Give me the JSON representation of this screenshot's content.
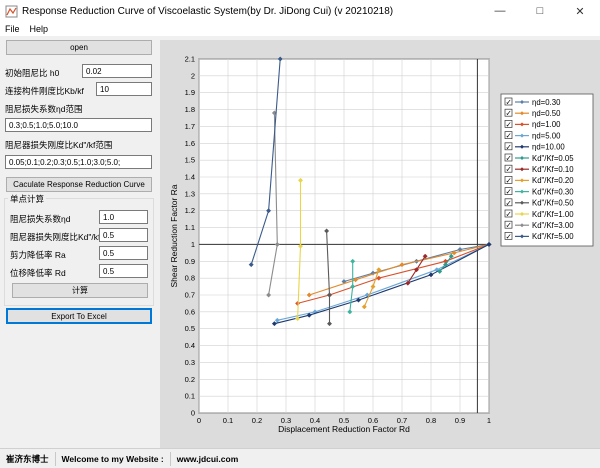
{
  "window": {
    "title": "Response Reduction Curve of Viscoelastic System(by Dr. JiDong Cui) (v 20210218)"
  },
  "menu": {
    "file": "File",
    "help": "Help"
  },
  "left": {
    "open_label": "open",
    "h0_label": "初始阻尼比 h0",
    "h0_value": "0.02",
    "kbkf_label": "连接构件刚度比Kb/kf",
    "kbkf_value": "10",
    "nd_range_label": "阻尼损失系数ηd范围",
    "nd_range_value": "0.3;0.5;1.0;5.0;10.0",
    "kd_range_label": "阻尼器损失刚度比Kd\"/kf范围",
    "kd_range_value": "0.05;0.1;0.2;0.3;0.5;1.0;3.0;5.0;",
    "calc_curve_label": "Caculate Response Reduction Curve",
    "single_group_label": "单点计算",
    "nd_label": "阻尼损失系数ηd",
    "nd_value": "1.0",
    "kd_label": "阻尼器损失刚度比Kd\"/kf",
    "kd_value": "0.5",
    "ra_label": "剪力降低率 Ra",
    "ra_value": "0.5",
    "rd_label": "位移降低率 Rd",
    "rd_value": "0.5",
    "compute_label": "计算",
    "export_label": "Export To Excel"
  },
  "status": {
    "author": "崔济东博士",
    "welcome": "Welcome to my Website :",
    "website": "www.jdcui.com"
  },
  "chart_data": {
    "type": "line",
    "xlabel": "Displacement Reduction Factor Rd",
    "ylabel": "Shear Reduction Factor Ra",
    "xlim": [
      0,
      1
    ],
    "ylim": [
      0,
      2.1
    ],
    "x_ticks": [
      "0",
      "0.1",
      "0.2",
      "0.3",
      "0.4",
      "0.5",
      "0.6",
      "0.7",
      "0.8",
      "0.9",
      "1"
    ],
    "y_ticks": [
      "0",
      "0.1",
      "0.2",
      "0.3",
      "0.4",
      "0.5",
      "0.6",
      "0.7",
      "0.8",
      "0.9",
      "1",
      "1.1",
      "1.2",
      "1.3",
      "1.4",
      "1.5",
      "1.6",
      "1.7",
      "1.8",
      "1.9",
      "2",
      "2.1"
    ],
    "ref_lines": {
      "x": 0.96,
      "y": 1.0
    },
    "grid": true,
    "legend_position": "right",
    "series": [
      {
        "name": "ηd=0.30",
        "color": "#5b7fa8",
        "marker": "diamond",
        "points": [
          [
            1,
            1
          ],
          [
            0.9,
            0.97
          ],
          [
            0.75,
            0.9
          ],
          [
            0.6,
            0.83
          ],
          [
            0.5,
            0.78
          ]
        ]
      },
      {
        "name": "ηd=0.50",
        "color": "#e38a2c",
        "marker": "diamond",
        "points": [
          [
            1,
            1
          ],
          [
            0.88,
            0.95
          ],
          [
            0.7,
            0.88
          ],
          [
            0.54,
            0.79
          ],
          [
            0.38,
            0.7
          ]
        ]
      },
      {
        "name": "ηd=1.00",
        "color": "#d9502a",
        "marker": "diamond",
        "points": [
          [
            1,
            1
          ],
          [
            0.85,
            0.9
          ],
          [
            0.62,
            0.8
          ],
          [
            0.45,
            0.7
          ],
          [
            0.34,
            0.65
          ]
        ]
      },
      {
        "name": "ηd=5.00",
        "color": "#6aa6d6",
        "marker": "diamond",
        "points": [
          [
            1,
            1
          ],
          [
            0.82,
            0.85
          ],
          [
            0.58,
            0.7
          ],
          [
            0.4,
            0.6
          ],
          [
            0.27,
            0.55
          ]
        ]
      },
      {
        "name": "ηd=10.00",
        "color": "#1f3a70",
        "marker": "diamond",
        "points": [
          [
            1,
            1
          ],
          [
            0.8,
            0.82
          ],
          [
            0.55,
            0.67
          ],
          [
            0.38,
            0.58
          ],
          [
            0.26,
            0.53
          ]
        ]
      },
      {
        "name": "Kd\"/Kf=0.05",
        "color": "#2e9c8e",
        "marker": "diamond",
        "points": [
          [
            0.87,
            0.93
          ],
          [
            0.85,
            0.88
          ],
          [
            0.83,
            0.84
          ]
        ]
      },
      {
        "name": "Kd\"/Kf=0.10",
        "color": "#9c2a2a",
        "marker": "diamond",
        "points": [
          [
            0.78,
            0.93
          ],
          [
            0.75,
            0.85
          ],
          [
            0.72,
            0.77
          ]
        ]
      },
      {
        "name": "Kd\"/Kf=0.20",
        "color": "#e3a02c",
        "marker": "diamond",
        "points": [
          [
            0.62,
            0.85
          ],
          [
            0.6,
            0.75
          ],
          [
            0.57,
            0.63
          ]
        ]
      },
      {
        "name": "Kd\"/Kf=0.30",
        "color": "#3cb4a0",
        "marker": "diamond",
        "points": [
          [
            0.53,
            0.9
          ],
          [
            0.53,
            0.75
          ],
          [
            0.52,
            0.6
          ]
        ]
      },
      {
        "name": "Kd\"/Kf=0.50",
        "color": "#5a5a5a",
        "marker": "diamond",
        "points": [
          [
            0.44,
            1.08
          ],
          [
            0.45,
            0.7
          ],
          [
            0.45,
            0.53
          ]
        ]
      },
      {
        "name": "Kd\"/Kf=1.00",
        "color": "#e8d54a",
        "marker": "diamond",
        "points": [
          [
            0.35,
            1.38
          ],
          [
            0.35,
            0.99
          ],
          [
            0.34,
            0.56
          ]
        ]
      },
      {
        "name": "Kd\"/Kf=3.00",
        "color": "#8c8c8c",
        "marker": "diamond",
        "points": [
          [
            0.26,
            1.78
          ],
          [
            0.27,
            1.0
          ],
          [
            0.24,
            0.7
          ]
        ]
      },
      {
        "name": "Kd\"/Kf=5.00",
        "color": "#3a5a8c",
        "marker": "diamond",
        "points": [
          [
            0.28,
            2.1
          ],
          [
            0.24,
            1.2
          ],
          [
            0.18,
            0.88
          ]
        ]
      }
    ]
  }
}
